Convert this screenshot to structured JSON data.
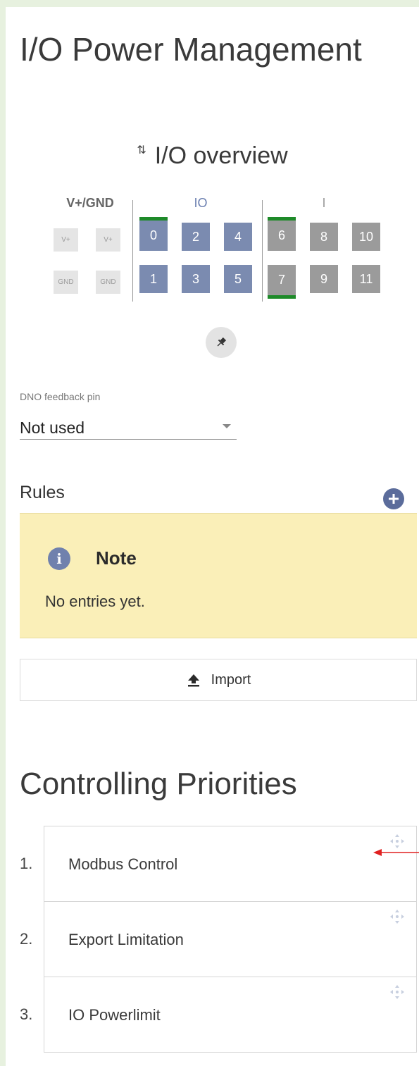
{
  "page": {
    "title": "I/O Power Management"
  },
  "overview": {
    "title": "I/O overview",
    "icon": "swap-vertical-icon",
    "groups": {
      "vgnd": "V+/GND",
      "io": "IO",
      "input": "I"
    },
    "vgnd_cells": [
      "V+",
      "V+",
      "GND",
      "GND"
    ],
    "io_cells": [
      "0",
      "2",
      "4",
      "1",
      "3",
      "5"
    ],
    "input_cells": [
      "6",
      "8",
      "10",
      "7",
      "9",
      "11"
    ],
    "active_indicator_color": "#1e8a29",
    "io_color": "#7b8bb0",
    "input_color": "#9b9b9b"
  },
  "pin_button": {
    "icon": "pin-icon"
  },
  "dno": {
    "label": "DNO feedback pin",
    "value": "Not used"
  },
  "rules": {
    "title": "Rules",
    "add_icon": "add-circle-icon",
    "note": {
      "title": "Note",
      "text": "No entries yet.",
      "background": "#faefb8"
    },
    "import_label": "Import",
    "import_icon": "upload-icon"
  },
  "priorities": {
    "title": "Controlling Priorities",
    "items": [
      {
        "number": "1.",
        "label": "Modbus Control"
      },
      {
        "number": "2.",
        "label": "Export Limitation"
      },
      {
        "number": "3.",
        "label": "IO Powerlimit"
      }
    ],
    "drag_icon": "drag-move-icon"
  },
  "colors": {
    "page_background": "#e7f1df",
    "accent": "#5b6c9b"
  }
}
